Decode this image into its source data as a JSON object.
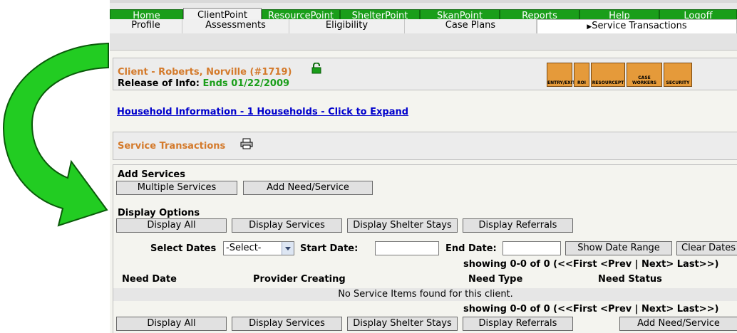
{
  "top_nav": {
    "tabs": [
      {
        "label": "Home",
        "active": false
      },
      {
        "label": "ClientPoint",
        "active": true
      },
      {
        "label": "ResourcePoint",
        "active": false
      },
      {
        "label": "ShelterPoint",
        "active": false
      },
      {
        "label": "SkanPoint",
        "active": false
      },
      {
        "label": "Reports",
        "active": false
      },
      {
        "label": "Help",
        "active": false
      },
      {
        "label": "Logoff",
        "active": false
      }
    ]
  },
  "sub_nav": {
    "tabs": [
      {
        "label": "Profile",
        "active": false
      },
      {
        "label": "Assessments",
        "active": false
      },
      {
        "label": "Eligibility",
        "active": false
      },
      {
        "label": "Case Plans",
        "active": false
      },
      {
        "label": "Service Transactions",
        "active": true
      }
    ]
  },
  "client": {
    "name": "Client - Roberts, Norville (#1719)",
    "roi_label": "Release of Info:",
    "roi_value": "Ends 01/22/2009",
    "lock_icon": "open-padlock-icon"
  },
  "toolbar_icons": [
    {
      "name": "entry-exit-icon",
      "label": "ENTRY/EXIT"
    },
    {
      "name": "roi-icon",
      "label": "ROI"
    },
    {
      "name": "resourcept-icon",
      "label": "RESOURCEPT"
    },
    {
      "name": "case-workers-icon",
      "label": "CASE WORKERS"
    },
    {
      "name": "security-icon",
      "label": "SECURITY"
    }
  ],
  "household_link": "Household Information - 1 Households - Click to Expand",
  "service_section": {
    "title": "Service Transactions",
    "print_icon": "printer-icon"
  },
  "add_services": {
    "label": "Add Services",
    "multiple_services": "Multiple Services",
    "add_need_service": "Add Need/Service"
  },
  "display_options": {
    "label": "Display Options",
    "display_all": "Display All",
    "display_services": "Display Services",
    "display_shelter_stays": "Display Shelter Stays",
    "display_referrals": "Display Referrals"
  },
  "date_filter": {
    "select_dates_label": "Select Dates",
    "select_value": "-Select-",
    "start_date_label": "Start Date:",
    "start_date_value": "",
    "end_date_label": "End Date:",
    "end_date_value": "",
    "show_range": "Show Date Range",
    "clear_dates": "Clear Dates"
  },
  "pagination": {
    "text": "showing 0-0 of 0 (<<First  <Prev | Next>  Last>>)"
  },
  "table": {
    "columns": [
      "Need Date",
      "Provider Creating",
      "Need Type",
      "Need Status"
    ],
    "empty_message": "No Service Items found for this client."
  },
  "bottom_buttons": {
    "display_all": "Display All",
    "display_services": "Display Services",
    "display_shelter_stays": "Display Shelter Stays",
    "display_referrals": "Display Referrals",
    "add_need_service": "Add Need/Service"
  },
  "colors": {
    "nav_green": "#1a9e1a",
    "accent_orange": "#d47a2b",
    "link_blue": "#0000cc",
    "arrow_green": "#22cc22"
  }
}
